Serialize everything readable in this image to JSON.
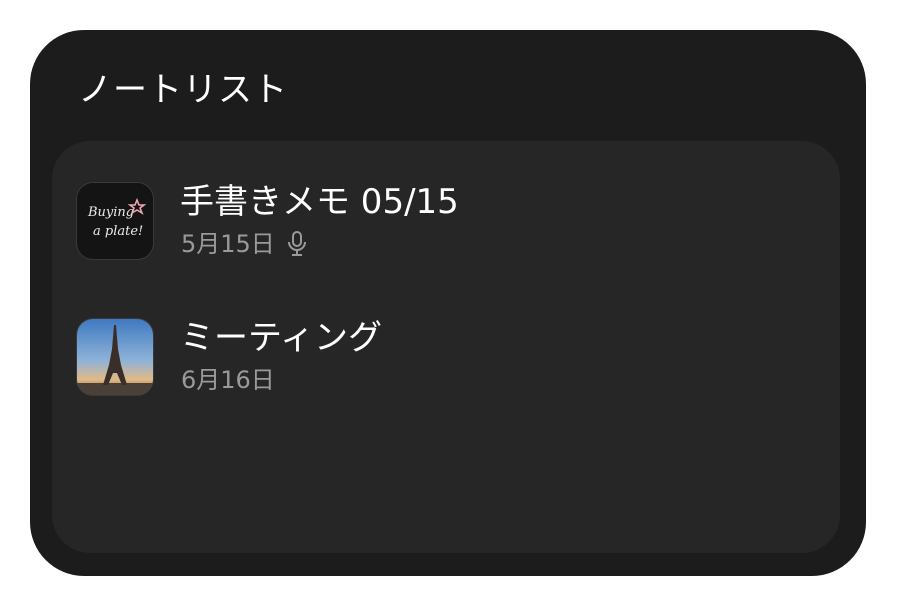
{
  "widget": {
    "title": "ノートリスト",
    "colors": {
      "background": "#1c1c1c",
      "panel": "#262626",
      "title_text": "#ffffff",
      "secondary_text": "#9a9a9a"
    }
  },
  "notes": [
    {
      "title": "手書きメモ 05/15",
      "date": "5月15日",
      "has_voice": true,
      "thumbnail": {
        "icon": "handwriting-thumbnail",
        "lines": [
          "Buying",
          "a plate!"
        ]
      }
    },
    {
      "title": "ミーティング",
      "date": "6月16日",
      "has_voice": false,
      "thumbnail": {
        "icon": "eiffel-tower-photo-thumbnail"
      }
    }
  ]
}
